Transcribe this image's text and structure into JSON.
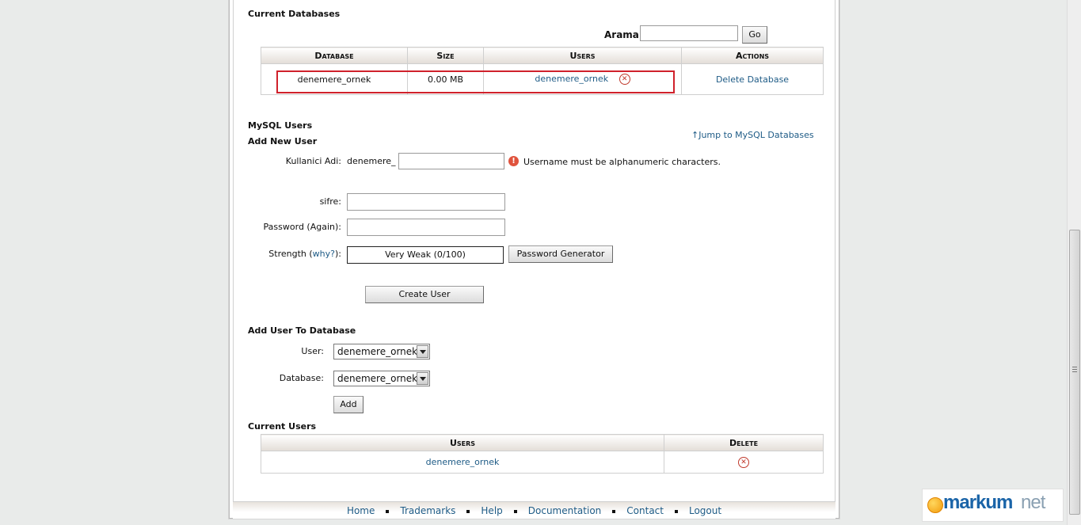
{
  "current_databases": {
    "heading": "Current Databases",
    "search_label": "Arama",
    "search_value": "",
    "go_label": "Go",
    "columns": [
      "Database",
      "Size",
      "Users",
      "Actions"
    ],
    "rows": [
      {
        "database": "denemere_ornek",
        "size": "0.00 MB",
        "user": "denemere_ornek",
        "action": "Delete Database"
      }
    ]
  },
  "mysql_users": {
    "heading": "MySQL Users",
    "jump_link": "Jump to MySQL Databases",
    "add_new_heading": "Add New User",
    "username_label": "Kullanici Adi:",
    "username_prefix": "denemere_",
    "username_value": "",
    "username_error": "Username must be alphanumeric characters.",
    "password_label": "sifre:",
    "password_again_label": "Password (Again):",
    "strength_label_pre": "Strength (",
    "strength_why": "why?",
    "strength_label_post": "):",
    "strength_value": "Very Weak (0/100)",
    "password_generator_label": "Password Generator",
    "create_user_label": "Create User"
  },
  "add_user_to_db": {
    "heading": "Add User To Database",
    "user_label": "User:",
    "user_selected": "denemere_ornek",
    "database_label": "Database:",
    "database_selected": "denemere_ornek",
    "add_label": "Add"
  },
  "current_users": {
    "heading": "Current Users",
    "columns": [
      "Users",
      "Delete"
    ],
    "rows": [
      {
        "user": "denemere_ornek"
      }
    ]
  },
  "footer": {
    "links": [
      "Home",
      "Trademarks",
      "Help",
      "Documentation",
      "Contact",
      "Logout"
    ]
  },
  "logo": {
    "part1": "markum",
    "part2": "net"
  },
  "colors": {
    "link": "#1e5b86",
    "highlight_box": "#d0212b",
    "error": "#e0533d"
  }
}
